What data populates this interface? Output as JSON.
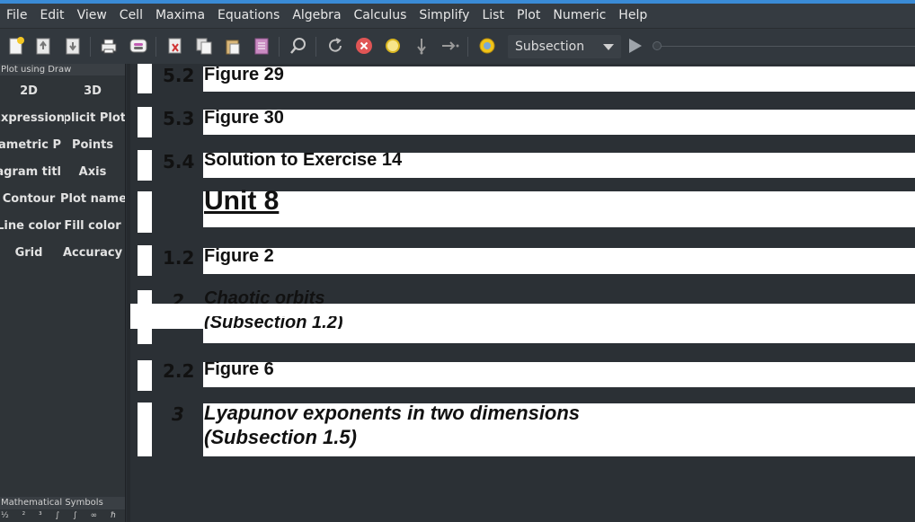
{
  "menubar": {
    "items": [
      "File",
      "Edit",
      "View",
      "Cell",
      "Maxima",
      "Equations",
      "Algebra",
      "Calculus",
      "Simplify",
      "List",
      "Plot",
      "Numeric",
      "Help"
    ]
  },
  "toolbar": {
    "icons": [
      "new-document-icon",
      "open-icon",
      "save-icon",
      "print-icon",
      "preferences-icon",
      "cut-icon",
      "copy-icon",
      "paste-icon",
      "select-all-icon",
      "find-icon",
      "restart-icon",
      "interrupt-icon",
      "follow-icon",
      "step-into-icon",
      "step-over-icon",
      "animation-icon",
      "play-icon"
    ],
    "style_select": "Subsection"
  },
  "sidebar": {
    "title": "Plot using Draw",
    "buttons": [
      "2D",
      "3D",
      "Expression",
      "Implicit Plot",
      "Parametric P",
      "Points",
      "Diagram titl",
      "Axis",
      "Contour",
      "Plot name",
      "Line color",
      "Fill color",
      "Grid",
      "Accuracy"
    ],
    "symbols_title": "Mathematical Symbols",
    "symbols_row": "½ ² ³ ∫ ∫ ∞ ℏ ∈"
  },
  "worksheet": {
    "cells": [
      {
        "number": "5.2",
        "text": "Figure 29"
      },
      {
        "number": "5.3",
        "text": "Figure 30"
      },
      {
        "number": "5.4",
        "text": "Solution to Exercise 14"
      },
      {
        "number": "",
        "text": "Unit 8"
      },
      {
        "number": "1.2",
        "text": "Figure 2"
      },
      {
        "number": "2",
        "line1": "Chaotic orbits",
        "line2": "(Subsection 1.2)"
      },
      {
        "number": "2.2",
        "text": "Figure 6"
      },
      {
        "number": "3",
        "line1": "Lyapunov exponents in two dimensions",
        "line2": "(Subsection 1.5)"
      }
    ]
  }
}
